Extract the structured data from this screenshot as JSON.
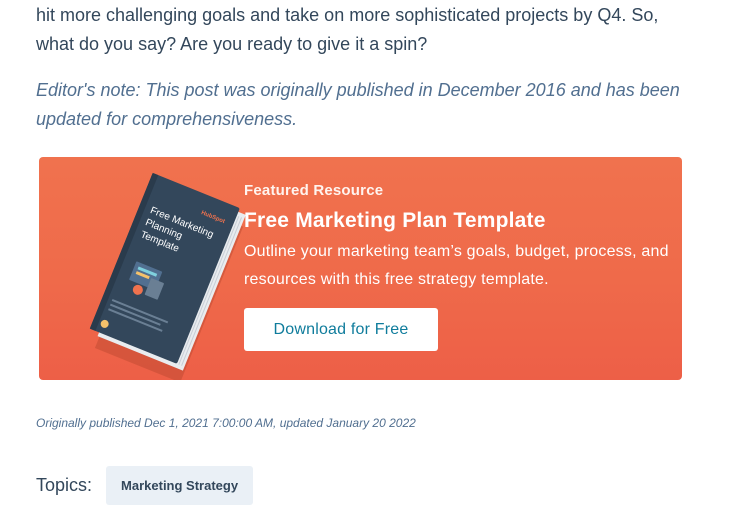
{
  "article": {
    "paragraph_tail": "hit more challenging goals and take on more sophisticated projects by Q4. So, what do you say? Are you ready to give it a spin?",
    "editors_note": "Editor's note: This post was originally published in December 2016 and has been updated for comprehensiveness."
  },
  "cta": {
    "eyebrow": "Featured Resource",
    "title": "Free Marketing Plan Template",
    "description": "Outline your marketing team’s goals, budget, process, and resources with this free strategy template.",
    "button_label": "Download for Free",
    "book": {
      "brand": "HubSpot",
      "title_line1": "Free Marketing",
      "title_line2": "Planning",
      "title_line3": "Template"
    },
    "colors": {
      "background": "#ef6a4a",
      "button_text": "#0f7c9c",
      "book_cover": "#33475b"
    }
  },
  "meta": {
    "published_text": "Originally published Dec 1, 2021 7:00:00 AM, updated January 20 2022"
  },
  "topics": {
    "label": "Topics:",
    "tags": [
      "Marketing Strategy"
    ]
  }
}
